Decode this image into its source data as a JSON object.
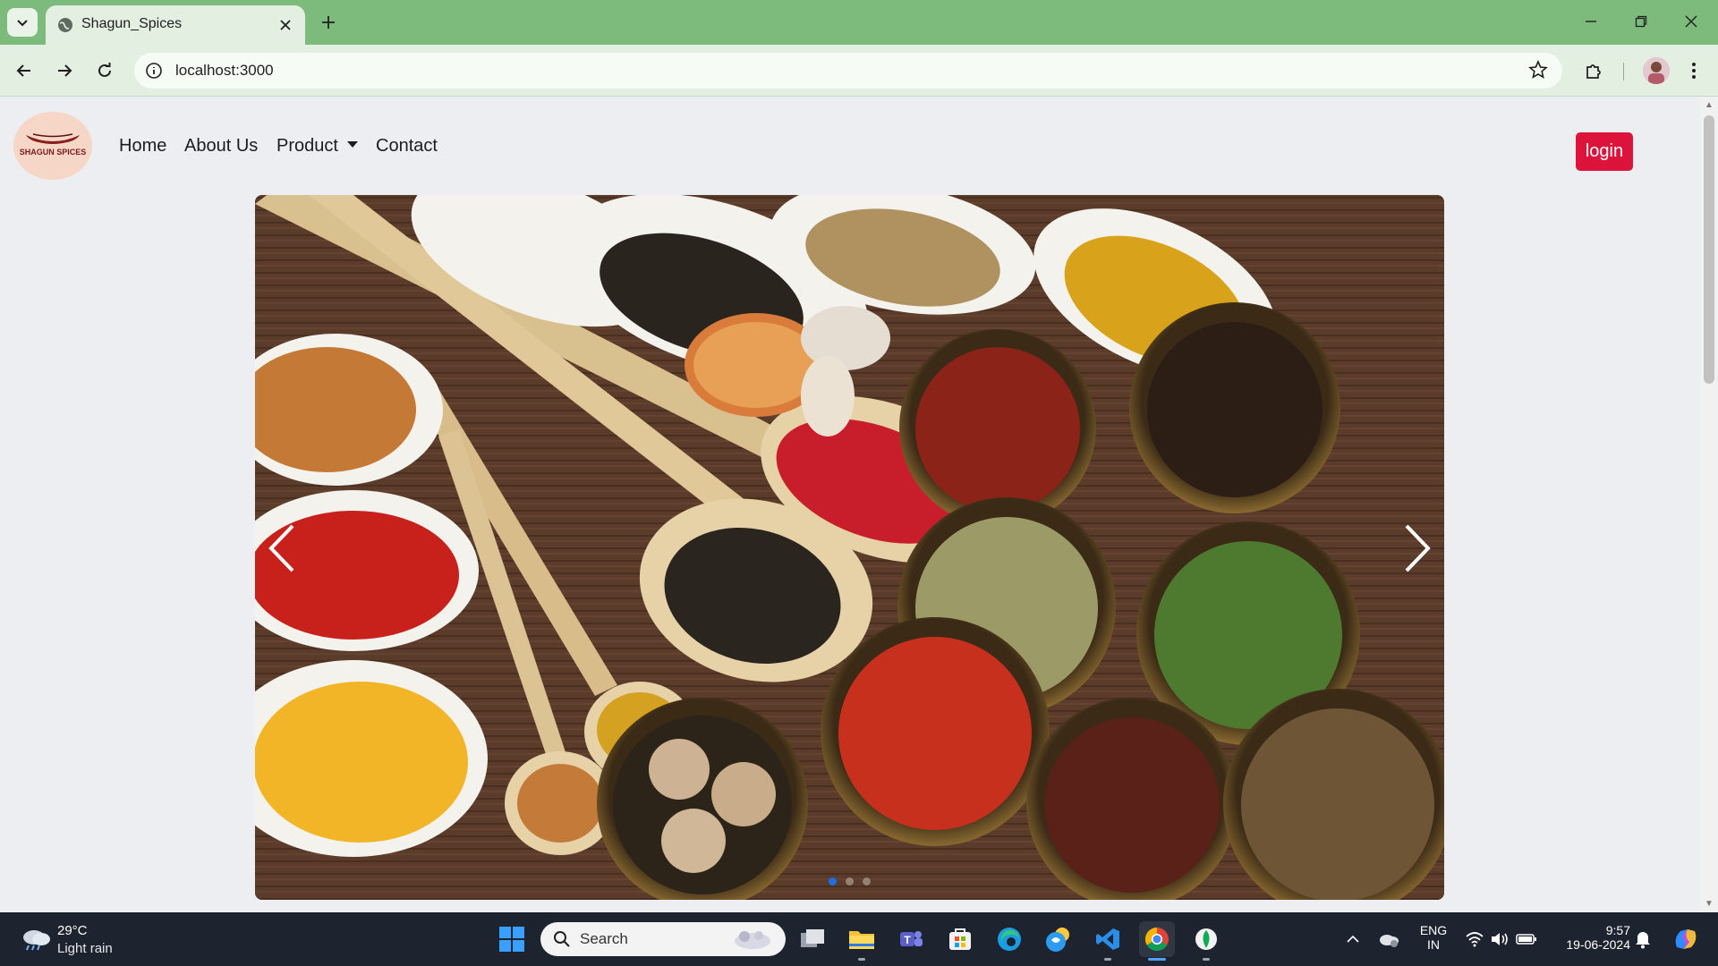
{
  "browser": {
    "tab_title": "Shagun_Spices",
    "url": "localhost:3000"
  },
  "site": {
    "logo_text": "SHAGUN SPICES",
    "nav": {
      "home": "Home",
      "about": "About Us",
      "product": "Product",
      "contact": "Contact"
    },
    "login_label": "login",
    "carousel": {
      "slide_count": 3,
      "active_index": 0
    }
  },
  "taskbar": {
    "weather_temp": "29°C",
    "weather_desc": "Light rain",
    "search_placeholder": "Search",
    "lang_primary": "ENG",
    "lang_secondary": "IN",
    "time": "9:57",
    "date": "19-06-2024"
  },
  "colors": {
    "tabbar": "#7cbb7c",
    "toolbar": "#e2efe1",
    "page_bg": "#eceef2",
    "login_button": "#dc143c",
    "carousel_indicator_active": "#1e6fe6",
    "taskbar": "#1d2430"
  }
}
